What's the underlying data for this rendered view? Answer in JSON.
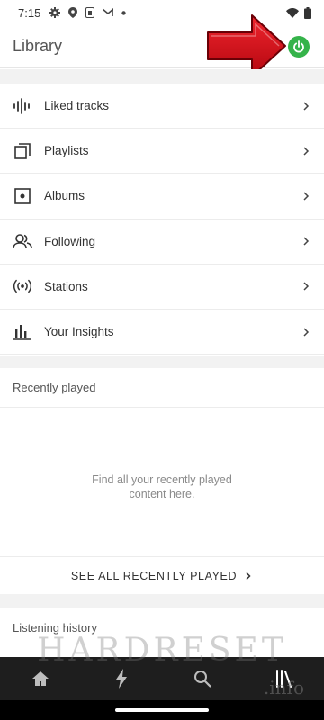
{
  "status_bar": {
    "time": "7:15",
    "icons": [
      "settings-icon",
      "location-icon",
      "sim-icon",
      "email-icon",
      "dot-icon"
    ],
    "right_icons": [
      "wifi-icon",
      "battery-icon"
    ]
  },
  "header": {
    "title": "Library",
    "power_icon": "power-icon",
    "power_color": "#35b34a"
  },
  "annotation": {
    "arrow_color": "#d8101b"
  },
  "menu": {
    "items": [
      {
        "label": "Liked tracks",
        "icon": "waveform-icon"
      },
      {
        "label": "Playlists",
        "icon": "playlists-icon"
      },
      {
        "label": "Albums",
        "icon": "album-icon"
      },
      {
        "label": "Following",
        "icon": "people-icon"
      },
      {
        "label": "Stations",
        "icon": "broadcast-icon"
      },
      {
        "label": "Your Insights",
        "icon": "bar-chart-icon"
      }
    ]
  },
  "recently_played": {
    "title": "Recently played",
    "empty_line1": "Find all your recently played",
    "empty_line2": "content here.",
    "see_all": "SEE ALL RECENTLY PLAYED"
  },
  "listening_history": {
    "title": "Listening history"
  },
  "bottom_nav": {
    "items": [
      "home-icon",
      "lightning-icon",
      "search-icon",
      "library-icon"
    ]
  },
  "watermark": {
    "text": "HARDRESET",
    "sub": ".info"
  }
}
